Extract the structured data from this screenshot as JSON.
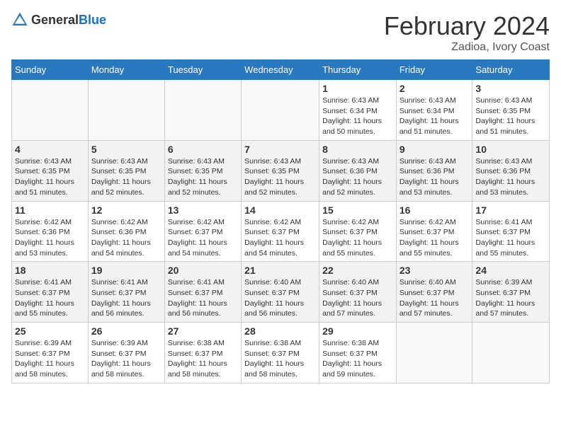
{
  "logo": {
    "text_general": "General",
    "text_blue": "Blue"
  },
  "title": "February 2024",
  "subtitle": "Zadioa, Ivory Coast",
  "days_of_week": [
    "Sunday",
    "Monday",
    "Tuesday",
    "Wednesday",
    "Thursday",
    "Friday",
    "Saturday"
  ],
  "weeks": [
    [
      {
        "day": "",
        "info": ""
      },
      {
        "day": "",
        "info": ""
      },
      {
        "day": "",
        "info": ""
      },
      {
        "day": "",
        "info": ""
      },
      {
        "day": "1",
        "info": "Sunrise: 6:43 AM\nSunset: 6:34 PM\nDaylight: 11 hours\nand 50 minutes."
      },
      {
        "day": "2",
        "info": "Sunrise: 6:43 AM\nSunset: 6:34 PM\nDaylight: 11 hours\nand 51 minutes."
      },
      {
        "day": "3",
        "info": "Sunrise: 6:43 AM\nSunset: 6:35 PM\nDaylight: 11 hours\nand 51 minutes."
      }
    ],
    [
      {
        "day": "4",
        "info": "Sunrise: 6:43 AM\nSunset: 6:35 PM\nDaylight: 11 hours\nand 51 minutes."
      },
      {
        "day": "5",
        "info": "Sunrise: 6:43 AM\nSunset: 6:35 PM\nDaylight: 11 hours\nand 52 minutes."
      },
      {
        "day": "6",
        "info": "Sunrise: 6:43 AM\nSunset: 6:35 PM\nDaylight: 11 hours\nand 52 minutes."
      },
      {
        "day": "7",
        "info": "Sunrise: 6:43 AM\nSunset: 6:35 PM\nDaylight: 11 hours\nand 52 minutes."
      },
      {
        "day": "8",
        "info": "Sunrise: 6:43 AM\nSunset: 6:36 PM\nDaylight: 11 hours\nand 52 minutes."
      },
      {
        "day": "9",
        "info": "Sunrise: 6:43 AM\nSunset: 6:36 PM\nDaylight: 11 hours\nand 53 minutes."
      },
      {
        "day": "10",
        "info": "Sunrise: 6:43 AM\nSunset: 6:36 PM\nDaylight: 11 hours\nand 53 minutes."
      }
    ],
    [
      {
        "day": "11",
        "info": "Sunrise: 6:42 AM\nSunset: 6:36 PM\nDaylight: 11 hours\nand 53 minutes."
      },
      {
        "day": "12",
        "info": "Sunrise: 6:42 AM\nSunset: 6:36 PM\nDaylight: 11 hours\nand 54 minutes."
      },
      {
        "day": "13",
        "info": "Sunrise: 6:42 AM\nSunset: 6:37 PM\nDaylight: 11 hours\nand 54 minutes."
      },
      {
        "day": "14",
        "info": "Sunrise: 6:42 AM\nSunset: 6:37 PM\nDaylight: 11 hours\nand 54 minutes."
      },
      {
        "day": "15",
        "info": "Sunrise: 6:42 AM\nSunset: 6:37 PM\nDaylight: 11 hours\nand 55 minutes."
      },
      {
        "day": "16",
        "info": "Sunrise: 6:42 AM\nSunset: 6:37 PM\nDaylight: 11 hours\nand 55 minutes."
      },
      {
        "day": "17",
        "info": "Sunrise: 6:41 AM\nSunset: 6:37 PM\nDaylight: 11 hours\nand 55 minutes."
      }
    ],
    [
      {
        "day": "18",
        "info": "Sunrise: 6:41 AM\nSunset: 6:37 PM\nDaylight: 11 hours\nand 55 minutes."
      },
      {
        "day": "19",
        "info": "Sunrise: 6:41 AM\nSunset: 6:37 PM\nDaylight: 11 hours\nand 56 minutes."
      },
      {
        "day": "20",
        "info": "Sunrise: 6:41 AM\nSunset: 6:37 PM\nDaylight: 11 hours\nand 56 minutes."
      },
      {
        "day": "21",
        "info": "Sunrise: 6:40 AM\nSunset: 6:37 PM\nDaylight: 11 hours\nand 56 minutes."
      },
      {
        "day": "22",
        "info": "Sunrise: 6:40 AM\nSunset: 6:37 PM\nDaylight: 11 hours\nand 57 minutes."
      },
      {
        "day": "23",
        "info": "Sunrise: 6:40 AM\nSunset: 6:37 PM\nDaylight: 11 hours\nand 57 minutes."
      },
      {
        "day": "24",
        "info": "Sunrise: 6:39 AM\nSunset: 6:37 PM\nDaylight: 11 hours\nand 57 minutes."
      }
    ],
    [
      {
        "day": "25",
        "info": "Sunrise: 6:39 AM\nSunset: 6:37 PM\nDaylight: 11 hours\nand 58 minutes."
      },
      {
        "day": "26",
        "info": "Sunrise: 6:39 AM\nSunset: 6:37 PM\nDaylight: 11 hours\nand 58 minutes."
      },
      {
        "day": "27",
        "info": "Sunrise: 6:38 AM\nSunset: 6:37 PM\nDaylight: 11 hours\nand 58 minutes."
      },
      {
        "day": "28",
        "info": "Sunrise: 6:38 AM\nSunset: 6:37 PM\nDaylight: 11 hours\nand 58 minutes."
      },
      {
        "day": "29",
        "info": "Sunrise: 6:38 AM\nSunset: 6:37 PM\nDaylight: 11 hours\nand 59 minutes."
      },
      {
        "day": "",
        "info": ""
      },
      {
        "day": "",
        "info": ""
      }
    ]
  ]
}
